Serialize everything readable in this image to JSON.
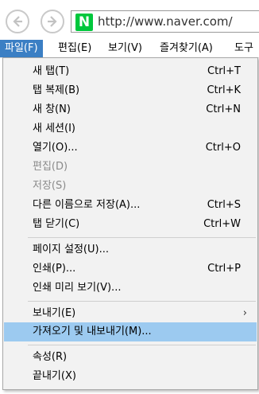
{
  "browser": {
    "url": "http://www.naver.com/",
    "logo_letter": "N",
    "colors": {
      "accent": "#3b7fc4",
      "hover": "#9ccaf0",
      "naver_green": "#00c73c"
    }
  },
  "menubar": {
    "file": "파일(F)",
    "edit": "편집(E)",
    "view": "보기(V)",
    "favorites": "즐겨찾기(A)",
    "tools": "도구"
  },
  "file_menu": {
    "items": [
      {
        "label": "새 탭(T)",
        "shortcut": "Ctrl+T"
      },
      {
        "label": "탭 복제(B)",
        "shortcut": "Ctrl+K"
      },
      {
        "label": "새 창(N)",
        "shortcut": "Ctrl+N"
      },
      {
        "label": "새 세션(I)",
        "shortcut": ""
      },
      {
        "label": "열기(O)...",
        "shortcut": "Ctrl+O"
      },
      {
        "label": "편집(D)",
        "shortcut": ""
      },
      {
        "label": "저장(S)",
        "shortcut": ""
      },
      {
        "label": "다른 이름으로 저장(A)...",
        "shortcut": "Ctrl+S"
      },
      {
        "label": "탭 닫기(C)",
        "shortcut": "Ctrl+W"
      },
      {
        "label": "페이지 설정(U)...",
        "shortcut": ""
      },
      {
        "label": "인쇄(P)...",
        "shortcut": "Ctrl+P"
      },
      {
        "label": "인쇄 미리 보기(V)...",
        "shortcut": ""
      },
      {
        "label": "보내기(E)",
        "shortcut": ""
      },
      {
        "label": "가져오기 및 내보내기(M)...",
        "shortcut": ""
      },
      {
        "label": "속성(R)",
        "shortcut": ""
      },
      {
        "label": "끝내기(X)",
        "shortcut": ""
      }
    ],
    "submenu_arrow": "›"
  }
}
